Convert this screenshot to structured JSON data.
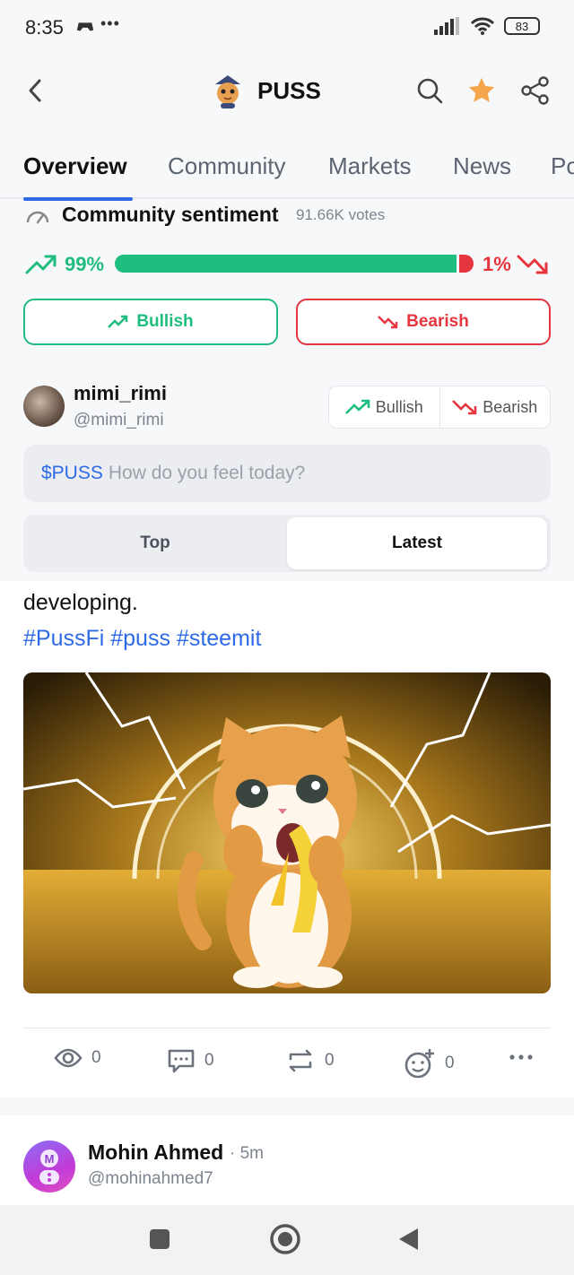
{
  "status_bar": {
    "time": "8:35",
    "dots": "•••",
    "battery": "83"
  },
  "header": {
    "title": "PUSS",
    "star_color": "#f6a64a"
  },
  "tabs": [
    {
      "label": "Overview",
      "active": true
    },
    {
      "label": "Community",
      "active": false
    },
    {
      "label": "Markets",
      "active": false
    },
    {
      "label": "News",
      "active": false
    },
    {
      "label": "Po",
      "active": false
    }
  ],
  "sentiment": {
    "title": "Community sentiment",
    "votes": "91.66K votes",
    "bullish_pct_label": "99%",
    "bearish_pct_label": "1%",
    "bullish_fraction": 0.99,
    "bullish_button": "Bullish",
    "bearish_button": "Bearish",
    "bull_color": "#1fbd7e",
    "bear_color": "#e5363f"
  },
  "composer": {
    "user_name": "mimi_rimi",
    "user_handle": "@mimi_rimi",
    "bullish_label": "Bullish",
    "bearish_label": "Bearish",
    "ticker": "$PUSS",
    "placeholder": "How do you feel today?"
  },
  "feed_tabs": {
    "top": "Top",
    "latest": "Latest",
    "selected": "Latest"
  },
  "post": {
    "text": "developing.",
    "hashtags": "#PussFi #puss #steemit",
    "image": "cartoon-cat-eating-banana-with-lightning",
    "views": "0",
    "comments": "0",
    "reposts": "0",
    "reactions": "0"
  },
  "next_post": {
    "author": "Mohin Ahmed",
    "time": "· 5m",
    "handle": "@mohinahmed7"
  },
  "accent_color": "#2f6ae6"
}
